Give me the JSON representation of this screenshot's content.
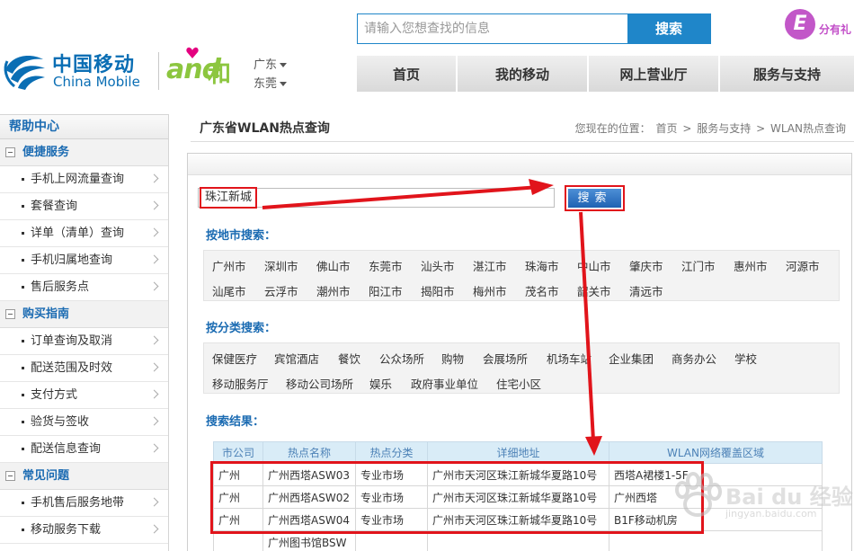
{
  "header": {
    "logo_cn": "中国移动",
    "logo_en": "China Mobile",
    "brand_and": "and",
    "brand_he": "和",
    "province": "广东",
    "city": "东莞",
    "search_placeholder": "请输入您想查找的信息",
    "search_button": "搜索",
    "promo_badge": "E",
    "promo_text": "分有礼"
  },
  "nav": {
    "items": [
      {
        "label": "首页"
      },
      {
        "label": "我的移动"
      },
      {
        "label": "网上营业厅"
      },
      {
        "label": "服务与支持"
      }
    ]
  },
  "sidebar": {
    "title": "帮助中心",
    "groups": [
      {
        "title": "便捷服务",
        "items": [
          "手机上网流量查询",
          "套餐查询",
          "详单（清单）查询",
          "手机归属地查询",
          "售后服务点"
        ]
      },
      {
        "title": "购买指南",
        "items": [
          "订单查询及取消",
          "配送范围及时效",
          "支付方式",
          "验货与签收",
          "配送信息查询"
        ]
      },
      {
        "title": "常见问题",
        "items": [
          "手机售后服务地带",
          "移动服务下载"
        ]
      }
    ]
  },
  "main": {
    "title": "广东省WLAN热点查询",
    "breadcrumb": {
      "prefix": "您现在的位置：",
      "items": [
        "首页",
        "服务与支持",
        "WLAN热点查询"
      ],
      "sep": ">"
    },
    "keyword_value": "珠江新城",
    "search_button": "搜索",
    "by_city_label": "按地市搜索：",
    "cities": [
      "广州市",
      "深圳市",
      "佛山市",
      "东莞市",
      "汕头市",
      "湛江市",
      "珠海市",
      "中山市",
      "肇庆市",
      "江门市",
      "惠州市",
      "河源市",
      "汕尾市",
      "云浮市",
      "潮州市",
      "阳江市",
      "揭阳市",
      "梅州市",
      "茂名市",
      "韶关市",
      "清远市"
    ],
    "by_category_label": "按分类搜索：",
    "categories": [
      "保健医疗",
      "宾馆酒店",
      "餐饮",
      "公众场所",
      "购物",
      "会展场所",
      "机场车站",
      "企业集团",
      "商务办公",
      "学校",
      "移动服务厅",
      "移动公司场所",
      "娱乐",
      "政府事业单位",
      "住宅小区"
    ],
    "results_label": "搜索结果：",
    "table": {
      "headers": [
        "市公司",
        "热点名称",
        "热点分类",
        "详细地址",
        "WLAN网络覆盖区域"
      ],
      "rows": [
        [
          "广州",
          "广州西塔ASW03",
          "专业市场",
          "广州市天河区珠江新城华夏路10号",
          "西塔A裙楼1-5F"
        ],
        [
          "广州",
          "广州西塔ASW02",
          "专业市场",
          "广州市天河区珠江新城华夏路10号",
          "广州西塔"
        ],
        [
          "广州",
          "广州西塔ASW04",
          "专业市场",
          "广州市天河区珠江新城华夏路10号",
          "B1F移动机房"
        ],
        [
          "",
          "广州图书馆BSW",
          "",
          "",
          ""
        ]
      ]
    }
  },
  "watermark": {
    "text": "Bai du 经验",
    "url": "jingyan.baidu.com"
  },
  "colors": {
    "brand_blue": "#1f86c9",
    "link_blue": "#1b6bb2",
    "highlight_red": "#e1141b",
    "and_green": "#8cc63f"
  }
}
